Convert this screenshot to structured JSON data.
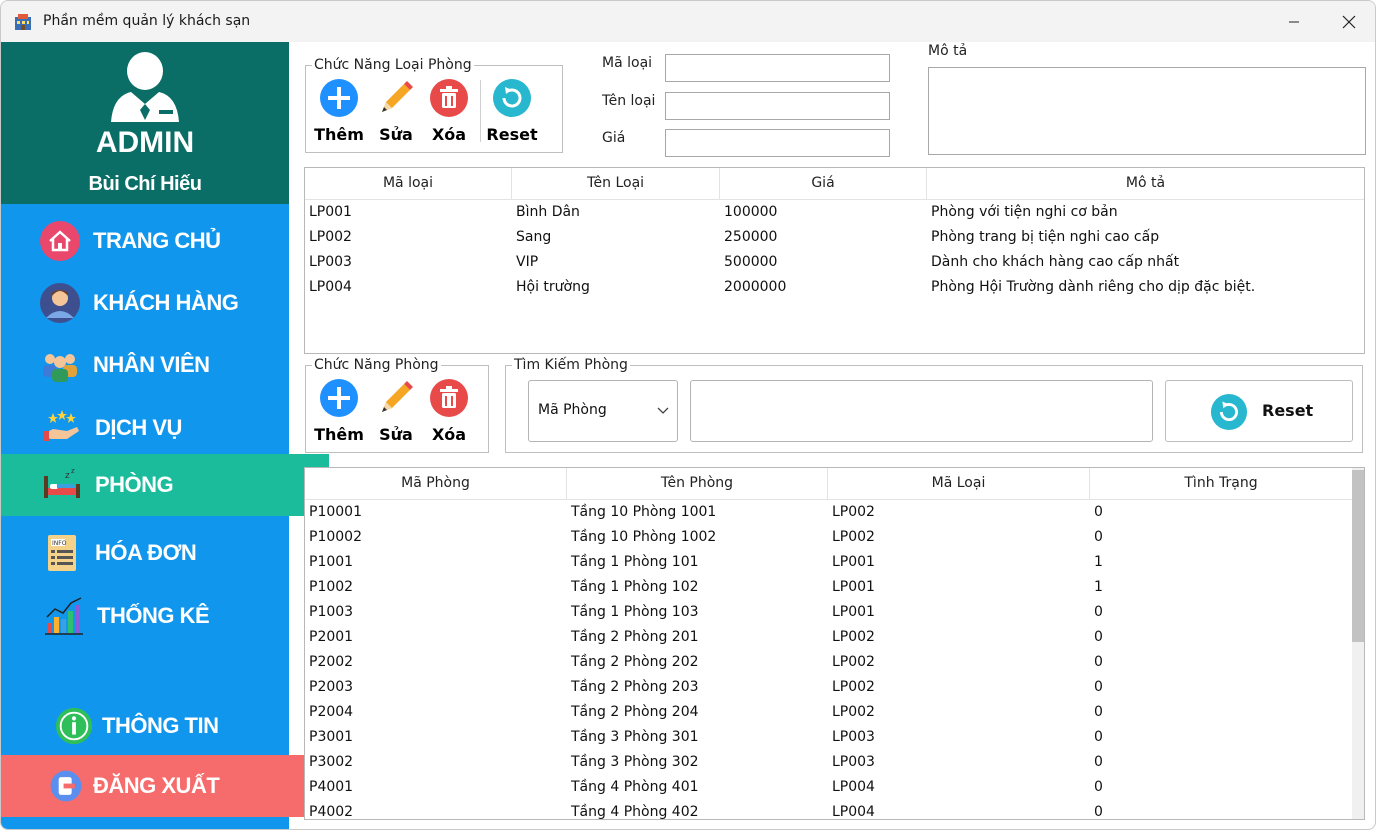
{
  "window": {
    "title": "Phần mềm quản lý khách sạn"
  },
  "sidebar": {
    "role": "ADMIN",
    "user_name": "Bùi Chí Hiếu",
    "items": [
      {
        "label": "TRANG CHỦ",
        "icon": "home-icon"
      },
      {
        "label": "KHÁCH HÀNG",
        "icon": "customer-icon"
      },
      {
        "label": "NHÂN VIÊN",
        "icon": "staff-icon"
      },
      {
        "label": "DỊCH VỤ",
        "icon": "service-icon"
      },
      {
        "label": "PHÒNG",
        "icon": "bed-icon",
        "active": true
      },
      {
        "label": "HÓA ĐƠN",
        "icon": "invoice-icon"
      },
      {
        "label": "THỐNG KÊ",
        "icon": "chart-icon"
      }
    ],
    "info_label": "THÔNG TIN",
    "logout_label": "ĐĂNG XUẤT",
    "colors": {
      "sidebar": "#1196ee",
      "profile": "#0a6e66",
      "active": "#1abc9c",
      "logout": "#f66b6b"
    }
  },
  "room_type_functions": {
    "title": "Chức Năng Loại Phòng",
    "add": "Thêm",
    "edit": "Sửa",
    "delete": "Xóa",
    "reset": "Reset"
  },
  "room_type_form": {
    "code_label": "Mã loại",
    "name_label": "Tên loại",
    "price_label": "Giá",
    "desc_label": "Mô tả",
    "code_value": "",
    "name_value": "",
    "price_value": "",
    "desc_value": ""
  },
  "room_type_table": {
    "columns": [
      "Mã loại",
      "Tên Loại",
      "Giá",
      "Mô tả"
    ],
    "rows": [
      [
        "LP001",
        "Bình Dân",
        "100000",
        "Phòng với tiện nghi cơ bản"
      ],
      [
        "LP002",
        "Sang",
        "250000",
        "Phòng trang bị tiện nghi cao cấp"
      ],
      [
        "LP003",
        "VIP",
        "500000",
        "Dành cho khách hàng cao cấp nhất"
      ],
      [
        "LP004",
        "Hội trường",
        "2000000",
        "Phòng Hội Trường dành riêng cho dịp đặc biệt."
      ]
    ]
  },
  "room_functions": {
    "title": "Chức Năng Phòng",
    "add": "Thêm",
    "edit": "Sửa",
    "delete": "Xóa"
  },
  "room_search": {
    "title": "Tìm Kiếm Phòng",
    "field": "Mã Phòng",
    "query": "",
    "reset": "Reset"
  },
  "room_table": {
    "columns": [
      "Mã Phòng",
      "Tên Phòng",
      "Mã Loại",
      "Tình Trạng"
    ],
    "rows": [
      [
        "P10001",
        "Tầng 10 Phòng 1001",
        "LP002",
        "0"
      ],
      [
        "P10002",
        "Tầng 10 Phòng 1002",
        "LP002",
        "0"
      ],
      [
        "P1001",
        "Tầng 1 Phòng 101",
        "LP001",
        "1"
      ],
      [
        "P1002",
        "Tầng 1 Phòng 102",
        "LP001",
        "1"
      ],
      [
        "P1003",
        "Tầng 1 Phòng 103",
        "LP001",
        "0"
      ],
      [
        "P2001",
        "Tầng 2 Phòng 201",
        "LP002",
        "0"
      ],
      [
        "P2002",
        "Tầng 2 Phòng 202",
        "LP002",
        "0"
      ],
      [
        "P2003",
        "Tầng 2 Phòng 203",
        "LP002",
        "0"
      ],
      [
        "P2004",
        "Tầng 2 Phòng 204",
        "LP002",
        "0"
      ],
      [
        "P3001",
        "Tầng 3 Phòng 301",
        "LP003",
        "0"
      ],
      [
        "P3002",
        "Tầng 3 Phòng 302",
        "LP003",
        "0"
      ],
      [
        "P4001",
        "Tầng 4 Phòng 401",
        "LP004",
        "0"
      ],
      [
        "P4002",
        "Tầng 4 Phòng 402",
        "LP004",
        "0"
      ]
    ]
  }
}
